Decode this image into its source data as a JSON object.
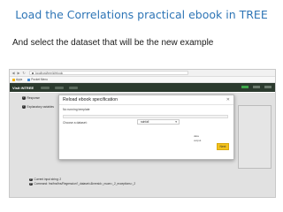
{
  "slide": {
    "title": "Load the Correlations practical ebook in TREE",
    "subtitle": "And select the dataset that will be the new example"
  },
  "browser": {
    "url": "localhost/tree/#/ebook",
    "bookmarks": [
      "Apps",
      "Pocket Menu"
    ]
  },
  "app": {
    "brand": "Visit iNTREE"
  },
  "page": {
    "field1": "Response",
    "field2": "Explanatory variables",
    "bottom_line1": "Current input string: 2",
    "bottom_line2": "Command: fns/fns/fns/Regression?_dataset=&lnresid=_nsum=_2_exceptions=_2"
  },
  "modal": {
    "title": "Reload ebook specification",
    "no_template_label": "No running template",
    "dataset_label": "Choose a dataset:",
    "dataset_value": "rainfall",
    "side_text_1": "data",
    "side_text_2": "output",
    "ok_label": "Next"
  }
}
